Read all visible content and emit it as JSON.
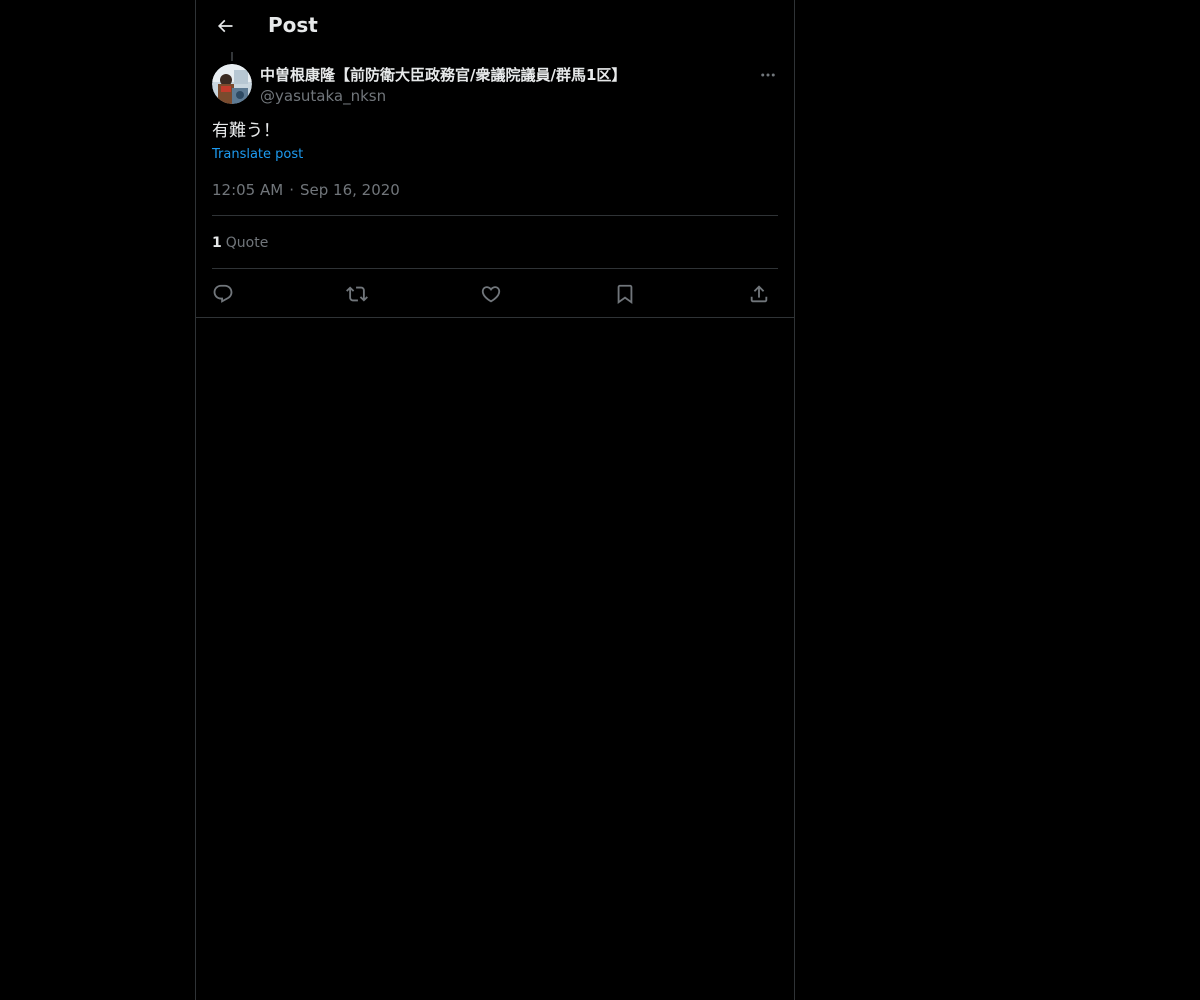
{
  "header": {
    "title": "Post",
    "back_icon": "arrow-left-icon"
  },
  "post": {
    "author": {
      "display_name": "中曽根康隆【前防衛大臣政務官/衆議院議員/群馬1区】",
      "handle": "@yasutaka_nksn",
      "avatar_icon": "avatar-photo"
    },
    "text": "有難う！",
    "translate_label": "Translate post",
    "time": "12:05 AM",
    "separator": "·",
    "date": "Sep 16, 2020",
    "stats": {
      "quote_count": "1",
      "quote_label": "Quote"
    },
    "more_icon": "more-horizontal-icon"
  },
  "actions": [
    {
      "name": "reply",
      "icon": "reply-icon"
    },
    {
      "name": "repost",
      "icon": "repost-icon"
    },
    {
      "name": "like",
      "icon": "heart-icon"
    },
    {
      "name": "bookmark",
      "icon": "bookmark-icon"
    },
    {
      "name": "share",
      "icon": "share-icon"
    }
  ],
  "colors": {
    "background": "#000000",
    "text_primary": "#e7e9ea",
    "text_secondary": "#71767b",
    "link": "#1d9bf0",
    "border": "#2f3336"
  }
}
